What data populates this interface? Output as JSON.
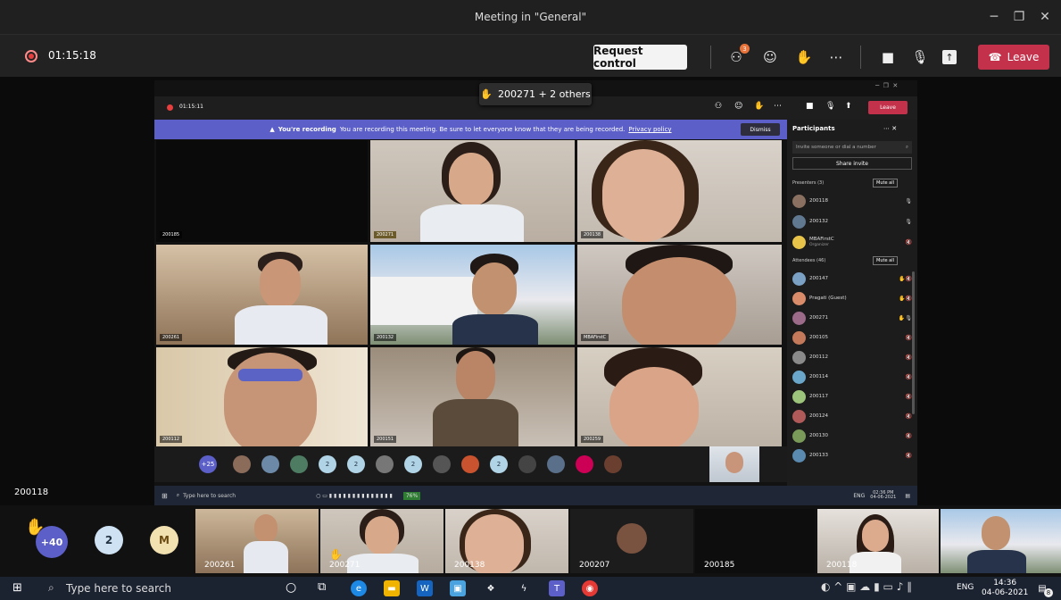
{
  "window": {
    "title": "Meeting in \"General\""
  },
  "toolbar": {
    "timer": "01:15:18",
    "request_control": "Request control",
    "leave": "Leave",
    "participants_badge": "3"
  },
  "inner": {
    "timer": "01:15:11",
    "raised_hand_popup": "200271 + 2 others",
    "recording_bold": "You're recording",
    "recording_text": "You are recording this meeting. Be sure to let everyone know that they are being recorded.",
    "privacy": "Privacy policy",
    "dismiss": "Dismiss",
    "leave": "Leave",
    "tiles": [
      "200185",
      "200271",
      "200138",
      "200261",
      "200132",
      "MBAFirstC",
      "200112",
      "200151",
      "200259"
    ],
    "panel": {
      "title": "Participants",
      "invite_placeholder": "Invite someone or dial a number",
      "share": "Share invite",
      "presenters": "Presenters (3)",
      "attendees": "Attendees (46)",
      "mute_all": "Mute all",
      "presenters_list": [
        {
          "name": "200118"
        },
        {
          "name": "200132"
        },
        {
          "name": "MBAFirstC",
          "sub": "Organizer"
        }
      ],
      "attendees_list": [
        {
          "name": "200147"
        },
        {
          "name": "Pragati (Guest)"
        },
        {
          "name": "200271"
        },
        {
          "name": "200105"
        },
        {
          "name": "200112"
        },
        {
          "name": "200114"
        },
        {
          "name": "200117"
        },
        {
          "name": "200124"
        },
        {
          "name": "200130"
        },
        {
          "name": "200133"
        }
      ]
    },
    "avatar_row": [
      "+25",
      "2",
      "2",
      "2",
      "2"
    ],
    "taskbar": {
      "search": "Type here to search",
      "battery": "76%",
      "lang": "ENG",
      "time": "02:36 PM",
      "date": "04-06-2021"
    }
  },
  "self_label": "200118",
  "strip": {
    "count": "+40",
    "two": "2",
    "m": "M",
    "tiles": [
      "200261",
      "200271",
      "200138",
      "200207",
      "200185",
      "200118",
      ""
    ]
  },
  "taskbar": {
    "search": "Type here to search",
    "lang": "ENG",
    "time": "14:36",
    "date": "04-06-2021",
    "notif": "8"
  }
}
